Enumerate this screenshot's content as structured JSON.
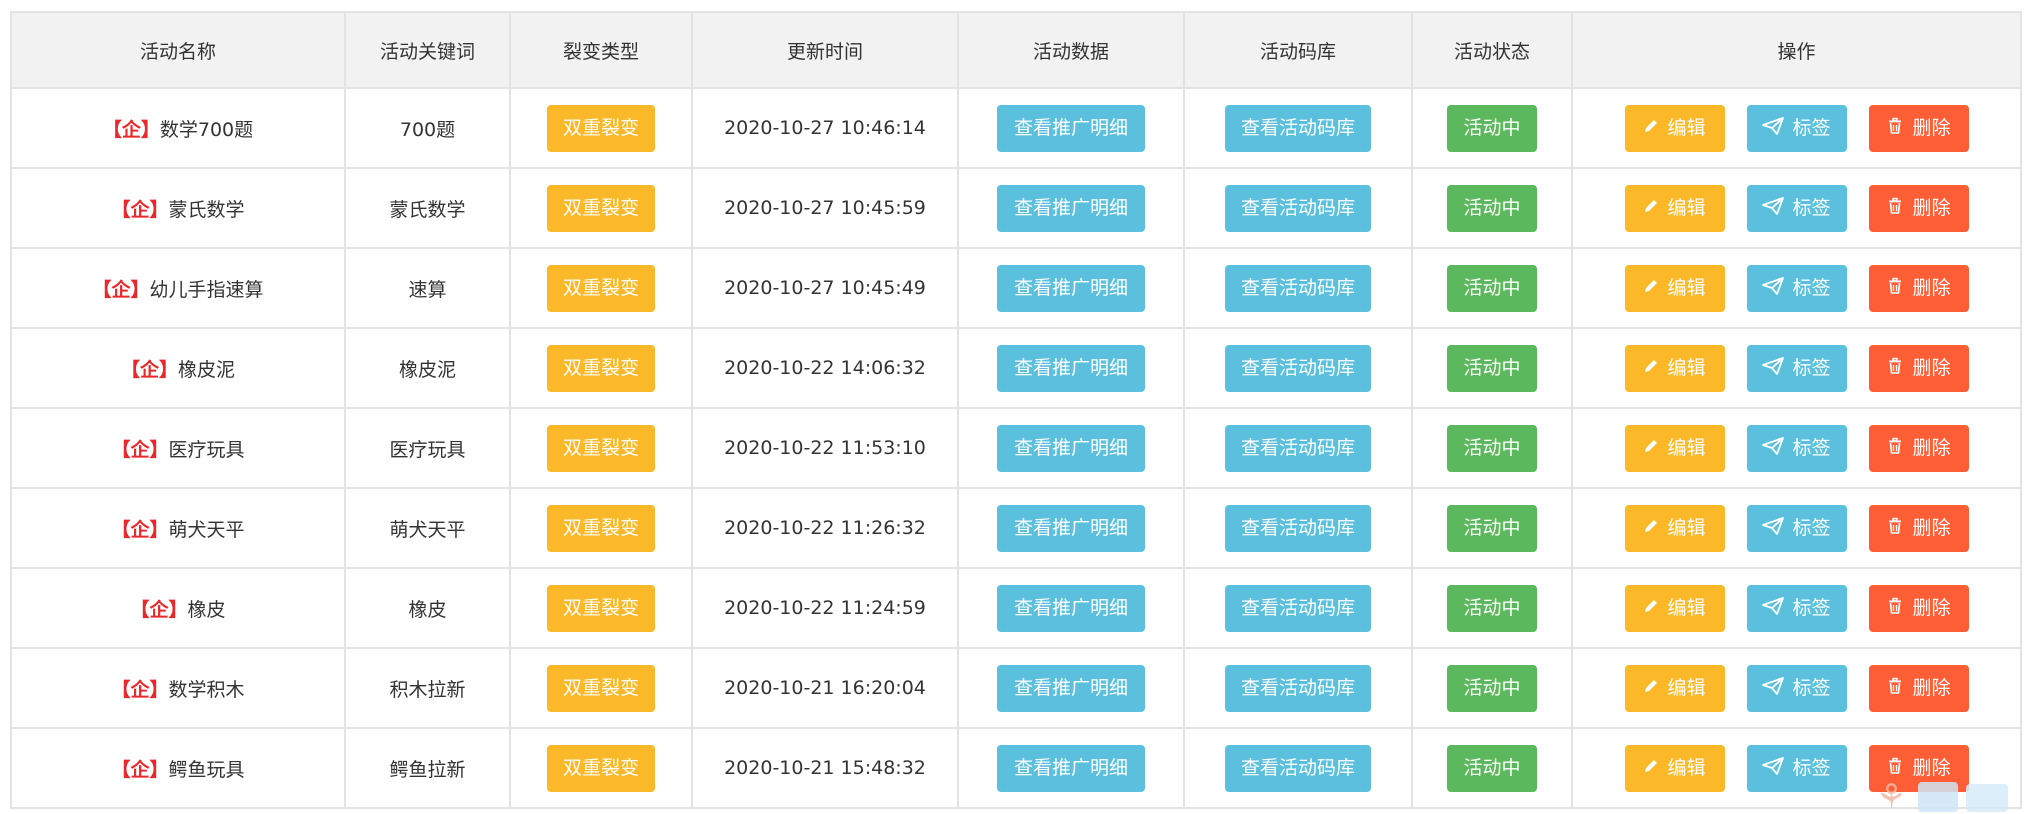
{
  "table": {
    "headers": [
      "活动名称",
      "活动关键词",
      "裂变类型",
      "更新时间",
      "活动数据",
      "活动码库",
      "活动状态",
      "操作"
    ],
    "rows": [
      {
        "prefix": "【企】",
        "name": "数学700题",
        "keyword": "700题",
        "type": "双重裂变",
        "updated": "2020-10-27 10:46:14",
        "data_btn": "查看推广明细",
        "codes_btn": "查看活动码库",
        "status": "活动中",
        "edit": "编辑",
        "tag": "标签",
        "delete": "删除"
      },
      {
        "prefix": "【企】",
        "name": "蒙氏数学",
        "keyword": "蒙氏数学",
        "type": "双重裂变",
        "updated": "2020-10-27 10:45:59",
        "data_btn": "查看推广明细",
        "codes_btn": "查看活动码库",
        "status": "活动中",
        "edit": "编辑",
        "tag": "标签",
        "delete": "删除"
      },
      {
        "prefix": "【企】",
        "name": "幼儿手指速算",
        "keyword": "速算",
        "type": "双重裂变",
        "updated": "2020-10-27 10:45:49",
        "data_btn": "查看推广明细",
        "codes_btn": "查看活动码库",
        "status": "活动中",
        "edit": "编辑",
        "tag": "标签",
        "delete": "删除"
      },
      {
        "prefix": "【企】",
        "name": "橡皮泥",
        "keyword": "橡皮泥",
        "type": "双重裂变",
        "updated": "2020-10-22 14:06:32",
        "data_btn": "查看推广明细",
        "codes_btn": "查看活动码库",
        "status": "活动中",
        "edit": "编辑",
        "tag": "标签",
        "delete": "删除"
      },
      {
        "prefix": "【企】",
        "name": "医疗玩具",
        "keyword": "医疗玩具",
        "type": "双重裂变",
        "updated": "2020-10-22 11:53:10",
        "data_btn": "查看推广明细",
        "codes_btn": "查看活动码库",
        "status": "活动中",
        "edit": "编辑",
        "tag": "标签",
        "delete": "删除"
      },
      {
        "prefix": "【企】",
        "name": "萌犬天平",
        "keyword": "萌犬天平",
        "type": "双重裂变",
        "updated": "2020-10-22 11:26:32",
        "data_btn": "查看推广明细",
        "codes_btn": "查看活动码库",
        "status": "活动中",
        "edit": "编辑",
        "tag": "标签",
        "delete": "删除"
      },
      {
        "prefix": "【企】",
        "name": "橡皮",
        "keyword": "橡皮",
        "type": "双重裂变",
        "updated": "2020-10-22 11:24:59",
        "data_btn": "查看推广明细",
        "codes_btn": "查看活动码库",
        "status": "活动中",
        "edit": "编辑",
        "tag": "标签",
        "delete": "删除"
      },
      {
        "prefix": "【企】",
        "name": "数学积木",
        "keyword": "积木拉新",
        "type": "双重裂变",
        "updated": "2020-10-21 16:20:04",
        "data_btn": "查看推广明细",
        "codes_btn": "查看活动码库",
        "status": "活动中",
        "edit": "编辑",
        "tag": "标签",
        "delete": "删除"
      },
      {
        "prefix": "【企】",
        "name": "鳄鱼玩具",
        "keyword": "鳄鱼拉新",
        "type": "双重裂变",
        "updated": "2020-10-21 15:48:32",
        "data_btn": "查看推广明细",
        "codes_btn": "查看活动码库",
        "status": "活动中",
        "edit": "编辑",
        "tag": "标签",
        "delete": "删除"
      }
    ]
  },
  "colors": {
    "type_button": "#fbb829",
    "info_button": "#5bc0de",
    "status_active": "#5cb85c",
    "delete_button": "#fe5e35",
    "qi_tag": "#e8292b"
  },
  "icons": {
    "edit": "pencil-icon",
    "tag": "paper-plane-icon",
    "delete": "trash-icon"
  }
}
